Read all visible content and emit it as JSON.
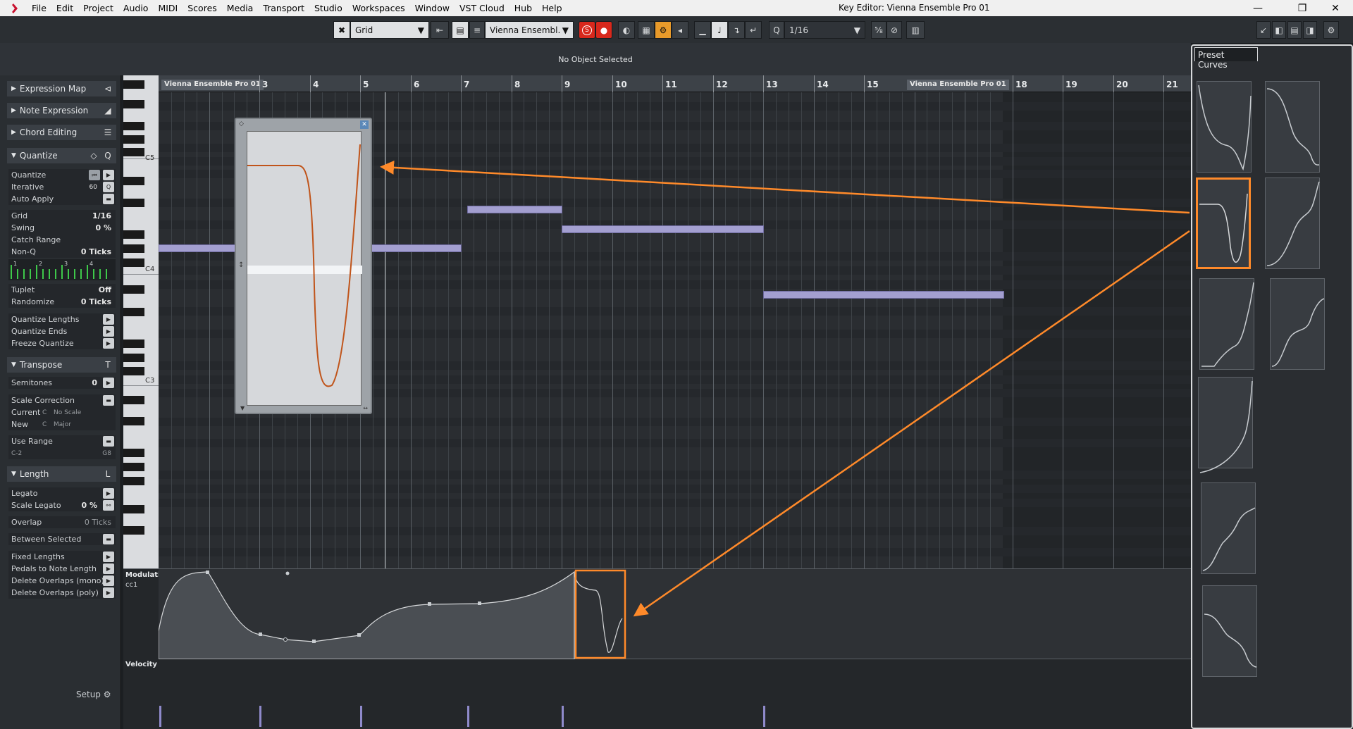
{
  "menubar": {
    "items": [
      "File",
      "Edit",
      "Project",
      "Audio",
      "MIDI",
      "Scores",
      "Media",
      "Transport",
      "Studio",
      "Workspaces",
      "Window",
      "VST Cloud",
      "Hub",
      "Help"
    ],
    "window_title": "Key Editor: Vienna Ensemble Pro 01"
  },
  "toolbar": {
    "snap_mode": "Grid",
    "track_select": "Vienna Ensembl.",
    "solo_label": "S",
    "quantize_label": "Q",
    "quantize_value": "1/16"
  },
  "infoline": {
    "status": "No Object Selected"
  },
  "inspector": {
    "sections": {
      "expression_map": "Expression Map",
      "note_expression": "Note Expression",
      "chord_editing": "Chord Editing",
      "quantize": "Quantize",
      "transpose": "Transpose",
      "length": "Length"
    },
    "quantize": {
      "quantize": "Quantize",
      "iterative": "Iterative",
      "iterative_value": "60",
      "auto_apply": "Auto Apply",
      "grid": "Grid",
      "grid_value": "1/16",
      "swing": "Swing",
      "swing_value": "0 %",
      "catch_range": "Catch Range",
      "non_q": "Non-Q",
      "non_q_value": "0 Ticks",
      "tuplet": "Tuplet",
      "tuplet_value": "Off",
      "randomize": "Randomize",
      "randomize_value": "0 Ticks",
      "quantize_lengths": "Quantize Lengths",
      "quantize_ends": "Quantize Ends",
      "freeze_quantize": "Freeze Quantize"
    },
    "transpose": {
      "semitones": "Semitones",
      "semitones_value": "0",
      "scale_correction": "Scale Correction",
      "current": "Current",
      "current_key": "C",
      "current_scale": "No Scale",
      "new": "New",
      "new_key": "C",
      "new_scale": "Major",
      "use_range": "Use Range",
      "range_low": "C-2",
      "range_high": "G8"
    },
    "length": {
      "legato": "Legato",
      "scale_legato": "Scale Legato",
      "scale_legato_value": "0 %",
      "overlap": "Overlap",
      "overlap_value": "0 Ticks",
      "between_selected": "Between Selected",
      "fixed_lengths": "Fixed Lengths",
      "pedals_to_note_length": "Pedals to Note Length",
      "delete_overlaps_mono": "Delete Overlaps (mono)",
      "delete_overlaps_poly": "Delete Overlaps (poly)"
    },
    "setup": "Setup"
  },
  "keyboard": {
    "labels": [
      "C5",
      "C4",
      "C3"
    ]
  },
  "ruler": {
    "numbers": [
      "3",
      "4",
      "5",
      "6",
      "7",
      "8",
      "9",
      "10",
      "11",
      "12",
      "13",
      "14",
      "15",
      "18",
      "19",
      "20",
      "21"
    ],
    "part_tags": [
      "Vienna Ensemble Pro 01",
      "Vienna Ensemble Pro 01"
    ]
  },
  "lanes": {
    "modulation": "Modulation",
    "cc": "cc1",
    "velocity": "Velocity"
  },
  "presets": {
    "title": "Preset Curves"
  },
  "colors": {
    "accent": "#ff8a2a",
    "note": "#a39fd0",
    "curve": "#c0541a"
  }
}
